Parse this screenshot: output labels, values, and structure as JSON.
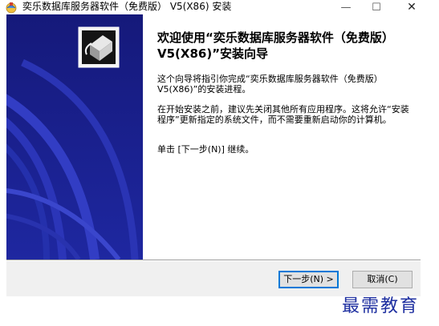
{
  "window": {
    "title": "奕乐数据库服务器软件（免费版） V5(X86) 安装",
    "minimize_glyph": "—",
    "maximize_glyph": "☐",
    "close_glyph": "✕"
  },
  "banner": {
    "background_color": "#1a1f86",
    "icon": "installer-box-icon"
  },
  "content": {
    "heading": "欢迎使用“奕乐数据库服务器软件（免费版） V5(X86)”安装向导",
    "paragraph1": "这个向导将指引你完成“奕乐数据库服务器软件（免费版） V5(X86)”的安装进程。",
    "paragraph2": "在开始安装之前，建议先关闭其他所有应用程序。这将允许“安装程序”更新指定的系统文件，而不需要重新启动你的计算机。",
    "paragraph3": "单击 [下一步(N)] 继续。"
  },
  "buttons": {
    "next": "下一步(N) >",
    "cancel": "取消(C)"
  },
  "watermark": {
    "text": "最需教育"
  }
}
